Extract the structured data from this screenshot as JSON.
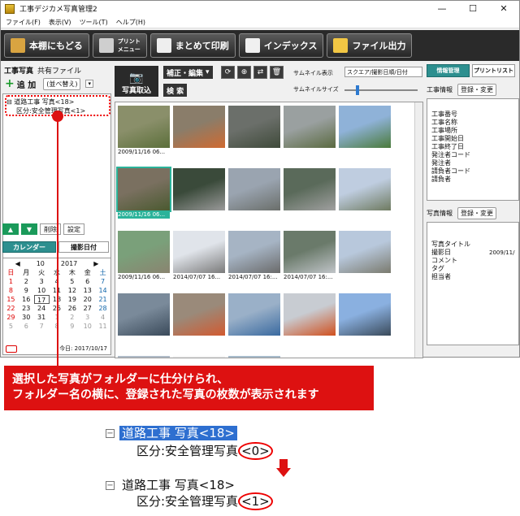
{
  "window": {
    "title": "工事デジカメ写真管理2",
    "min": "—",
    "max": "☐",
    "close": "✕"
  },
  "menu": [
    "ファイル(F)",
    "表示(V)",
    "ツール(T)",
    "ヘルプ(H)"
  ],
  "toolbar": {
    "back": "本棚にもどる",
    "print_menu": "プリント\nメニュー",
    "batch_print": "まとめて印刷",
    "index": "インデックス",
    "file_out": "ファイル出力"
  },
  "left": {
    "tab1": "工事写真",
    "tab2": "共有ファイル",
    "add": "追 加",
    "sort": "(並べ替え)",
    "tree_node": "道路工事 写真<18>",
    "tree_child": "区分:安全管理写真<1>",
    "delete": "削除",
    "settings": "設定",
    "calendar_tab": "カレンダー",
    "date_tab": "撮影日付"
  },
  "calendar": {
    "month": "10",
    "year": "2017",
    "weekdays": [
      "日",
      "月",
      "火",
      "水",
      "木",
      "金",
      "土"
    ],
    "days": [
      [
        "1",
        "2",
        "3",
        "4",
        "5",
        "6",
        "7"
      ],
      [
        "8",
        "9",
        "10",
        "11",
        "12",
        "13",
        "14"
      ],
      [
        "15",
        "16",
        "17",
        "18",
        "19",
        "20",
        "21"
      ],
      [
        "22",
        "23",
        "24",
        "25",
        "26",
        "27",
        "28"
      ],
      [
        "29",
        "30",
        "31",
        "1",
        "2",
        "3",
        "4"
      ],
      [
        "5",
        "6",
        "7",
        "8",
        "9",
        "10",
        "11"
      ]
    ],
    "today_label": "今日: 2017/10/17"
  },
  "center": {
    "import": "写真取込",
    "edit": "補正・編集",
    "search": "検 索",
    "thumb_display_label": "サムネイル表示",
    "thumb_display_value": "スクエア/撮影日順/日付",
    "thumb_size_label": "サムネイルサイズ"
  },
  "thumbs": [
    {
      "cap": "2009/11/16 06...",
      "c1": "#8a8f6a",
      "c2": "#5b6f3a"
    },
    {
      "cap": "",
      "c1": "#8a7d6a",
      "c2": "#d06a30"
    },
    {
      "cap": "",
      "c1": "#6b6f6a",
      "c2": "#3f4a3a"
    },
    {
      "cap": "",
      "c1": "#9aa0a0",
      "c2": "#5a6a40"
    },
    {
      "cap": "",
      "c1": "#8fb2d8",
      "c2": "#4a7a3a"
    },
    {
      "cap": "2009/11/16 06...",
      "c1": "#7a7060",
      "c2": "#4a5a30"
    },
    {
      "cap": "",
      "c1": "#3a4a3a",
      "c2": "#9a9a9a"
    },
    {
      "cap": "",
      "c1": "#9aa4b0",
      "c2": "#6a6e6a"
    },
    {
      "cap": "",
      "c1": "#5a6a5a",
      "c2": "#a0a0a0"
    },
    {
      "cap": "",
      "c1": "#bfcde0",
      "c2": "#6e7a60"
    },
    {
      "cap": "2009/11/16 06...",
      "c1": "#7aa07a",
      "c2": "#8a8470"
    },
    {
      "cap": "2014/07/07 16...",
      "c1": "#e0e4ea",
      "c2": "#7a7a7a"
    },
    {
      "cap": "2014/07/07 16:...",
      "c1": "#a6b4c4",
      "c2": "#6a6a6a"
    },
    {
      "cap": "2014/07/07 16:...",
      "c1": "#6a7a6a",
      "c2": "#c0c4c8"
    },
    {
      "cap": "",
      "c1": "#b8c8dc",
      "c2": "#7a7a6e"
    },
    {
      "cap": "",
      "c1": "#7a8a9a",
      "c2": "#3a4a5a"
    },
    {
      "cap": "",
      "c1": "#9a8a7a",
      "c2": "#d25a30"
    },
    {
      "cap": "",
      "c1": "#9ab0c8",
      "c2": "#3a6aa0"
    },
    {
      "cap": "",
      "c1": "#c8ccd2",
      "c2": "#d0501e"
    },
    {
      "cap": "",
      "c1": "#8ab0e0",
      "c2": "#3a4a5a"
    },
    {
      "cap": "",
      "c1": "#b0bcc8",
      "c2": "#7a705a"
    },
    {
      "cap": "",
      "c1": "#f4f4f4",
      "c2": "#aaaaaa"
    },
    {
      "cap": "",
      "c1": "#a8bccc",
      "c2": "#6a6a5a"
    }
  ],
  "right": {
    "tab_info": "情報管理",
    "tab_print": "プリントリスト",
    "work_info": "工事情報",
    "register": "登録・変更",
    "work_fields": [
      "工事番号",
      "工事名称",
      "工事場所",
      "工事開始日",
      "工事終了日",
      "発注者コード",
      "発注者",
      "請負者コード",
      "請負者"
    ],
    "photo_info": "写真情報",
    "photo_fields": [
      "写真タイトル",
      "撮影日",
      "コメント",
      "タグ",
      "担当者"
    ],
    "shoot_date": "2009/11/"
  },
  "callout": {
    "line1": "選択した写真がフォルダーに仕分けられ、",
    "line2": "フォルダー名の横に、登録された写真の枚数が表示されます"
  },
  "zoom": {
    "folder": "道路工事 写真<18>",
    "child_prefix": "区分:安全管理写真",
    "before": "<0>",
    "after": "<1>",
    "minus": "−"
  },
  "colors": {
    "accent": "#2d8f8f",
    "alert": "#dd1111"
  }
}
